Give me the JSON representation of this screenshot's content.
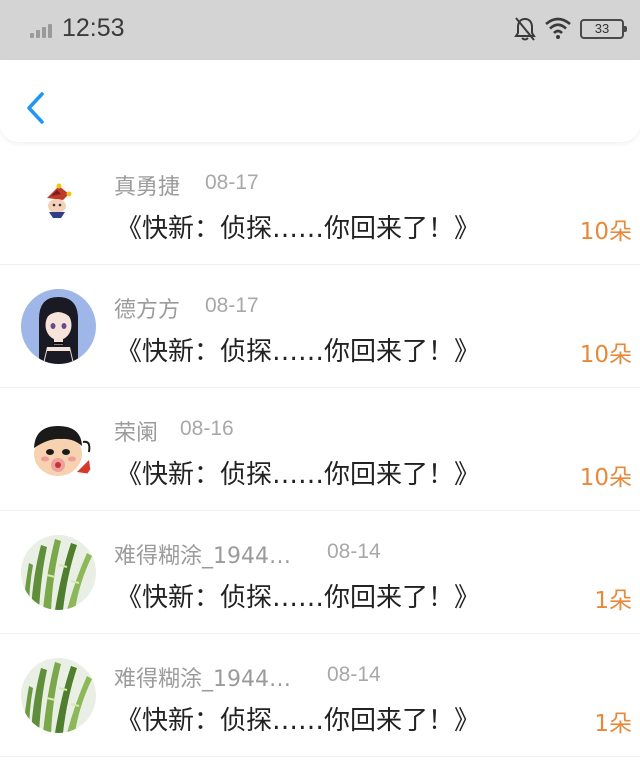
{
  "status_bar": {
    "time": "12:53",
    "battery": "33",
    "icons": [
      "signal-icon",
      "bell-off-icon",
      "wifi-icon",
      "battery-icon"
    ]
  },
  "nav": {
    "back_icon": "chevron-left-icon",
    "accent": "#2196f3"
  },
  "colors": {
    "count": "#e8883a",
    "name": "#9b9b9b",
    "title": "#222222"
  },
  "items": [
    {
      "name": "真勇捷",
      "date": "08-17",
      "title": "《快新：侦探……你回来了！》",
      "count": "10朵",
      "avatar": "jester-hat-sticker"
    },
    {
      "name": "德方方",
      "date": "08-17",
      "title": "《快新：侦探……你回来了！》",
      "count": "10朵",
      "avatar": "anime-girl"
    },
    {
      "name": "荣阑",
      "date": "08-16",
      "title": "《快新：侦探……你回来了！》",
      "count": "10朵",
      "avatar": "cartoon-boy"
    },
    {
      "name": "难得糊涂_1944…",
      "date": "08-14",
      "title": "《快新：侦探……你回来了！》",
      "count": "1朵",
      "avatar": "green-plant"
    },
    {
      "name": "难得糊涂_1944…",
      "date": "08-14",
      "title": "《快新：侦探……你回来了！》",
      "count": "1朵",
      "avatar": "green-plant"
    }
  ]
}
